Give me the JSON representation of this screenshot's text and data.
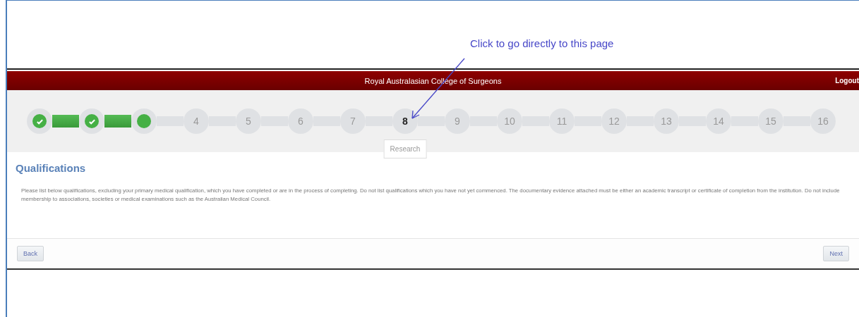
{
  "annotation": {
    "text": "Click to go directly to this page"
  },
  "header": {
    "title": "Royal Australasian College of Surgeons",
    "logout": "Logout"
  },
  "steps": [
    {
      "kind": "done"
    },
    {
      "kind": "done"
    },
    {
      "kind": "current"
    },
    {
      "kind": "todo",
      "label": "4",
      "hovered": false
    },
    {
      "kind": "todo",
      "label": "5",
      "hovered": false
    },
    {
      "kind": "todo",
      "label": "6",
      "hovered": false
    },
    {
      "kind": "todo",
      "label": "7",
      "hovered": false
    },
    {
      "kind": "todo",
      "label": "8",
      "hovered": true,
      "tooltip": "Research"
    },
    {
      "kind": "todo",
      "label": "9",
      "hovered": false
    },
    {
      "kind": "todo",
      "label": "10",
      "hovered": false
    },
    {
      "kind": "todo",
      "label": "11",
      "hovered": false
    },
    {
      "kind": "todo",
      "label": "12",
      "hovered": false
    },
    {
      "kind": "todo",
      "label": "13",
      "hovered": false
    },
    {
      "kind": "todo",
      "label": "14",
      "hovered": false
    },
    {
      "kind": "todo",
      "label": "15",
      "hovered": false
    },
    {
      "kind": "todo",
      "label": "16",
      "hovered": false
    }
  ],
  "section": {
    "title": "Qualifications",
    "text": "Please list below qualifications, excluding your primary medical qualification, which you have completed or are in the process of completing. Do not list qualifications which you have not yet commenced. The documentary evidence attached must be either an academic transcript or certificate of completion from the institution. Do not include membership to associations, societies or medical examinations such as the Australian Medical Council."
  },
  "buttons": {
    "back": "Back",
    "next": "Next"
  }
}
